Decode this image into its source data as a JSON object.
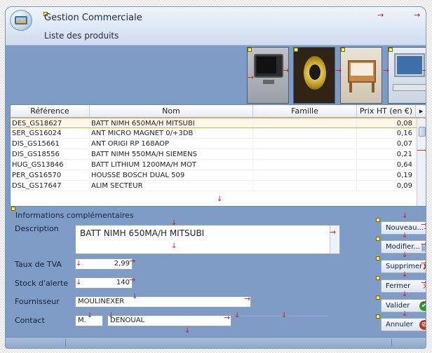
{
  "app": {
    "title": "Gestion Commerciale",
    "subtitle": "Liste des produits"
  },
  "grid": {
    "columns": [
      "Référence",
      "Nom",
      "Famille",
      "Prix HT (en €)"
    ],
    "rows": [
      [
        "DES_GS18627",
        "BATT NIMH 650MA/H MITSUBI",
        "",
        "0,08"
      ],
      [
        "SER_GS16024",
        "ANT MICRO MAGNET 0/+3DB",
        "",
        "0,16"
      ],
      [
        "DIS_GS15661",
        "ANT ORIGI RP 168AOP",
        "",
        "0,07"
      ],
      [
        "DIS_GS18556",
        "BATT NIMH 550MA/H SIEMENS",
        "",
        "0,21"
      ],
      [
        "HUG_GS13846",
        "BATT LITHIUM 1200MA/H MOT",
        "",
        "0,64"
      ],
      [
        "PER_GS16570",
        "HOUSSE BOSCH DUAL 509",
        "",
        "0,19"
      ],
      [
        "DSL_GS17647",
        "ALIM SECTEUR",
        "",
        "0,09"
      ]
    ]
  },
  "info": {
    "section_title": "Informations complémentaires",
    "description_label": "Description",
    "description_value": "BATT NIMH 650MA/H MITSUBI",
    "tva_label": "Taux de TVA",
    "tva_value": "2,99",
    "stock_label": "Stock d'alerte",
    "stock_value": "140",
    "fournisseur_label": "Fournisseur",
    "fournisseur_value": "MOULINEXER",
    "contact_label": "Contact",
    "contact_civilite": "M.",
    "contact_nom": "DENOUAL",
    "contact_extra": ""
  },
  "buttons": {
    "nouveau": "Nouveau...",
    "modifier": "Modifier...",
    "supprimer": "Supprimer",
    "fermer": "Fermer",
    "valider": "Valider",
    "annuler": "Annuler"
  },
  "icons": {
    "nouveau": "plus-icon",
    "modifier": "edit-icon",
    "supprimer": "cross-icon",
    "fermer": "close-icon",
    "valider": "check-icon",
    "annuler": "cancel-icon"
  },
  "colors": {
    "accent": "#7e9cc6",
    "selection_border": "#e6a54c",
    "marker_arrow": "#c81e1e"
  }
}
